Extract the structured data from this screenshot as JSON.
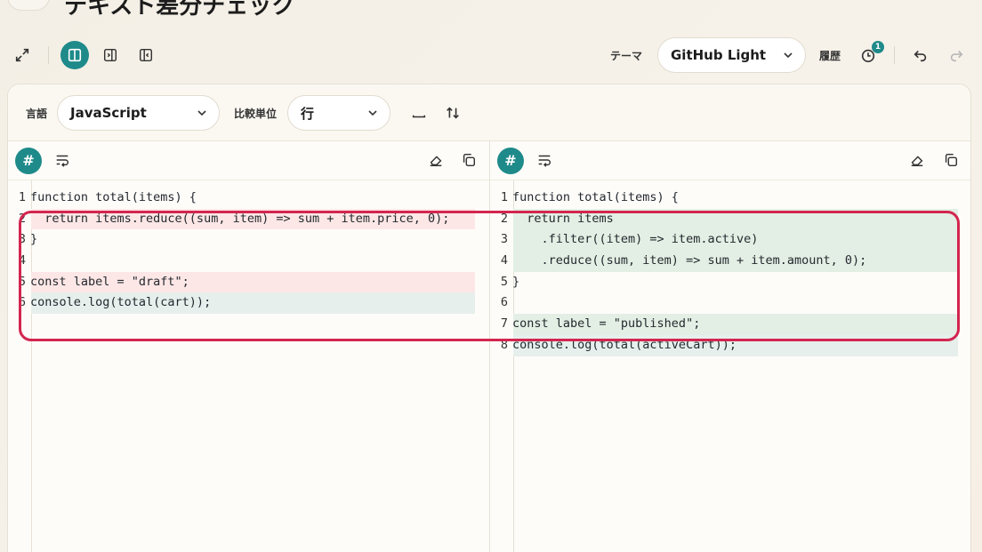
{
  "app": {
    "title": "テキスト差分チェック",
    "badge": "1"
  },
  "toolbar": {
    "theme_label": "テーマ",
    "theme_value": "GitHub Light",
    "history_label": "履歴",
    "history_count": "1"
  },
  "options": {
    "language_label": "言語",
    "language_value": "JavaScript",
    "unit_label": "比較単位",
    "unit_value": "行"
  },
  "left": {
    "lines": [
      {
        "n": "1",
        "t": "function total(items) {",
        "kind": "none"
      },
      {
        "n": "2",
        "t": "  return items.reduce((sum, item) => sum + item.price, 0);",
        "kind": "del"
      },
      {
        "n": "3",
        "t": "}",
        "kind": "none"
      },
      {
        "n": "4",
        "t": "",
        "kind": "none"
      },
      {
        "n": "5",
        "t": "const label = \"draft\";",
        "kind": "del"
      },
      {
        "n": "6",
        "t": "console.log(total(cart));",
        "kind": "mod"
      }
    ]
  },
  "right": {
    "lines": [
      {
        "n": "1",
        "t": "function total(items) {",
        "kind": "none"
      },
      {
        "n": "2",
        "t": "  return items",
        "kind": "add"
      },
      {
        "n": "3",
        "t": "    .filter((item) => item.active)",
        "kind": "add"
      },
      {
        "n": "4",
        "t": "    .reduce((sum, item) => sum + item.amount, 0);",
        "kind": "add"
      },
      {
        "n": "5",
        "t": "}",
        "kind": "none"
      },
      {
        "n": "6",
        "t": "",
        "kind": "none"
      },
      {
        "n": "7",
        "t": "const label = \"published\";",
        "kind": "add"
      },
      {
        "n": "8",
        "t": "console.log(total(activeCart));",
        "kind": "mod"
      }
    ]
  },
  "colors": {
    "accent": "#1f8a8a",
    "del_bg": "#fde7e6",
    "add_bg": "#e3efe4",
    "annotation": "#d3264f"
  }
}
